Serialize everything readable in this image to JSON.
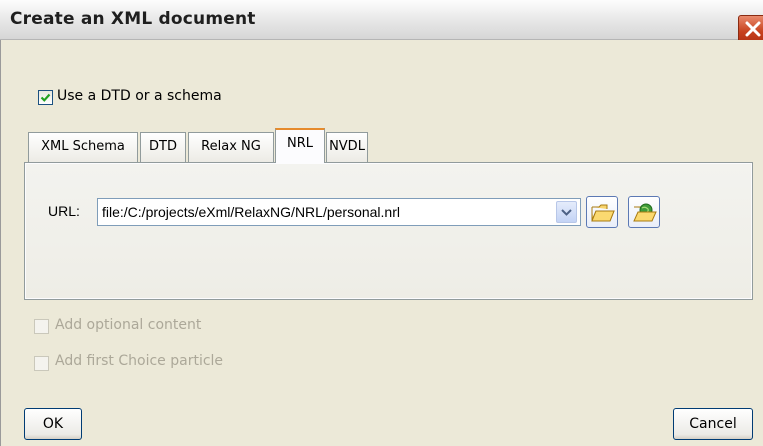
{
  "window": {
    "title": "Create an XML document"
  },
  "options": {
    "use_dtd_schema": {
      "label": "Use a DTD or a schema",
      "checked": true
    },
    "add_optional_content": {
      "label": "Add optional content",
      "checked": false,
      "enabled": false
    },
    "add_first_choice": {
      "label": "Add first Choice particle",
      "checked": false,
      "enabled": false
    }
  },
  "tabs": [
    {
      "label": "XML Schema"
    },
    {
      "label": "DTD"
    },
    {
      "label": "Relax NG"
    },
    {
      "label": "NRL",
      "active": true
    },
    {
      "label": "NVDL"
    }
  ],
  "url": {
    "label": "URL:",
    "value": "file:/C:/projects/eXml/RelaxNG/NRL/personal.nrl"
  },
  "icons": {
    "close": "close-icon",
    "dropdown": "chevron-down-icon",
    "browse": "open-folder-icon",
    "browse_url": "open-url-folder-icon"
  },
  "buttons": {
    "ok": "OK",
    "cancel": "Cancel"
  },
  "colors": {
    "active_tab_accent": "#e68b2c",
    "close_button": "#c7421f",
    "checkbox_border": "#1c5180"
  }
}
